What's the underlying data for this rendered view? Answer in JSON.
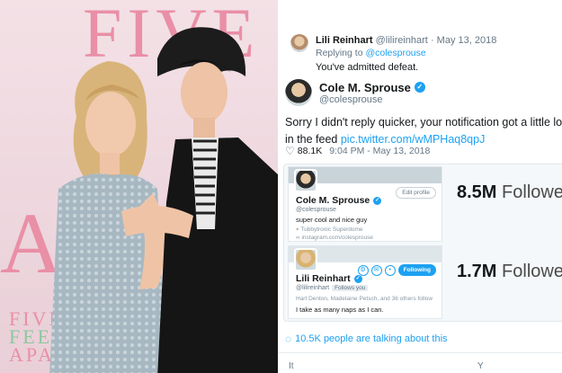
{
  "photo": {
    "backdrop_text_top": "FIVE",
    "backdrop_text_mid": "A",
    "backdrop_small_lines": [
      "FIVE",
      "FEET",
      "APART"
    ],
    "colors": {
      "backdrop_pink": "#e98fa6",
      "backdrop_green": "#8cc7a0"
    }
  },
  "reply_tweet": {
    "name": "Lili Reinhart",
    "handle": "@lilireinhart",
    "date": "· May 13, 2018",
    "replying_prefix": "Replying to ",
    "replying_handle": "@colesprouse",
    "body": "You've admitted defeat."
  },
  "main_tweet": {
    "name": "Cole M. Sprouse",
    "handle": "@colesprouse",
    "body_text": "Sorry I didn't reply quicker, your notification got a little lost in the feed ",
    "link": "pic.twitter.com/wMPHaq8qpJ",
    "likes": "88.1K",
    "timestamp": "9:04 PM - May 13, 2018",
    "talking": "10.5K people are talking about this"
  },
  "embedded": {
    "profile1": {
      "name": "Cole M. Sprouse",
      "handle": "@colesprouse",
      "bio": "super cool and nice guy",
      "location": "Tubbytronic Superdome",
      "website": "instagram.com/colesprouse",
      "button": "Edit profile",
      "followers_count": "8.5M",
      "followers_label": "Followe"
    },
    "profile2": {
      "name": "Lili Reinhart",
      "handle": "@lilireinhart",
      "follows_you": "Follows you",
      "mutuals": "Hart Denton, Madelaine Petsch, and 36 others follow",
      "bio": "I take as many naps as I can.",
      "button": "Following",
      "followers_count": "1.7M",
      "followers_label": "Followe"
    }
  },
  "footer_fragments": [
    "It",
    "Y"
  ],
  "icons": [
    "verified-badge-icon",
    "heart-icon",
    "speech-bubble-icon",
    "location-pin-icon",
    "link-icon"
  ],
  "colors": {
    "twitter_blue": "#1da1f2",
    "text": "#14171a",
    "muted": "#657786"
  }
}
